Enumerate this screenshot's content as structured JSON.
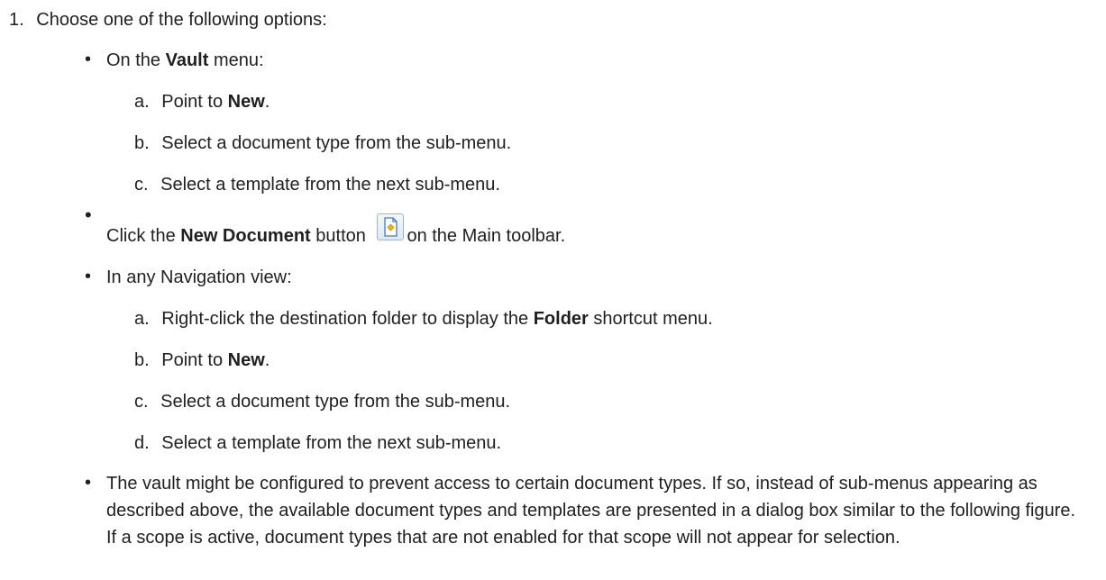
{
  "step": {
    "number": "1.",
    "text": "Choose one of the following options:"
  },
  "options": {
    "vault": {
      "prefix": "On the ",
      "menu": "Vault",
      "suffix": " menu:",
      "steps": [
        {
          "letter": "a.",
          "text_prefix": "Point to ",
          "bold": "New",
          "text_suffix": "."
        },
        {
          "letter": "b.",
          "text": "Select a document type from the sub-menu."
        },
        {
          "letter": "c.",
          "text": "Select a template from the next sub-menu."
        }
      ]
    },
    "toolbar": {
      "prefix": "Click the ",
      "button": "New Document",
      "middle": " button",
      "suffix": " on the Main toolbar.",
      "icon": "new-document-icon"
    },
    "navigation": {
      "text": "In any Navigation view:",
      "steps": [
        {
          "letter": "a.",
          "text_prefix": "Right-click the destination folder to display the ",
          "bold": "Folder",
          "text_suffix": " shortcut menu."
        },
        {
          "letter": "b.",
          "text_prefix": "Point to ",
          "bold": "New",
          "text_suffix": "."
        },
        {
          "letter": "c.",
          "text": "Select a document type from the sub-menu."
        },
        {
          "letter": "d.",
          "text": "Select a template from the next sub-menu."
        }
      ]
    },
    "note": {
      "text": "The vault might be configured to prevent access to certain document types. If so, instead of sub-menus appearing as described above, the available document types and templates are presented in a dialog box similar to the following figure. If a scope is active, document types that are not enabled for that scope will not appear for selection."
    }
  },
  "colors": {
    "text": "#1f1f1f",
    "icon_border": "#9fb4cc",
    "icon_page": "#ffffff",
    "icon_accent": "#f5b400",
    "icon_blue": "#3a7bd5"
  }
}
